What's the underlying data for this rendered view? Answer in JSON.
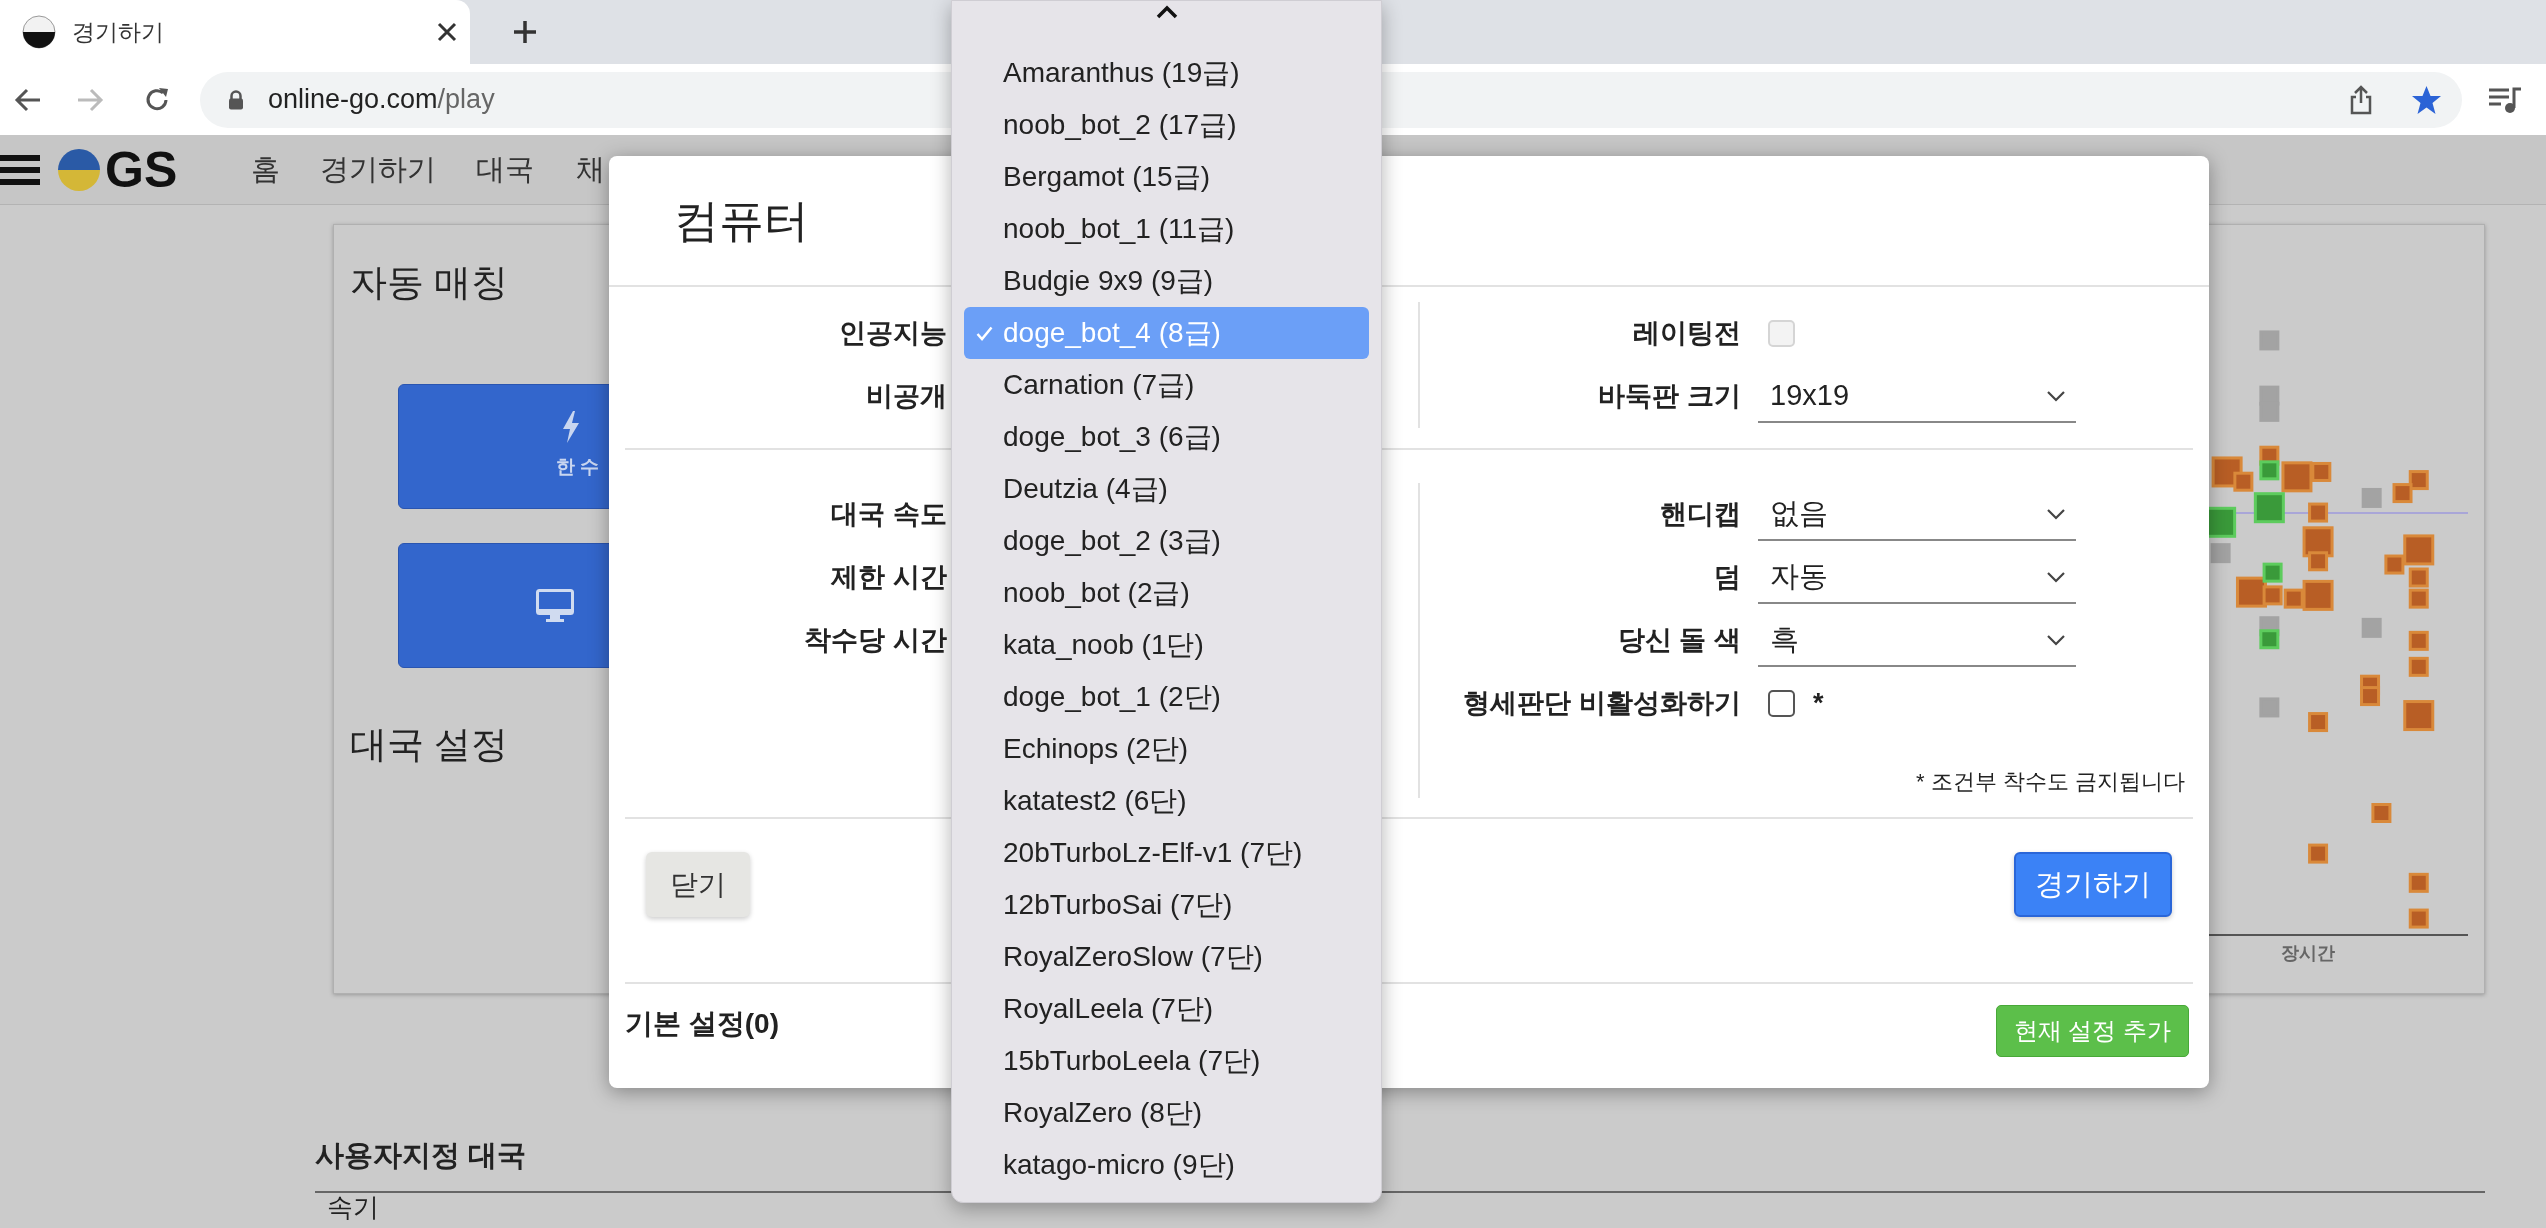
{
  "browser": {
    "tab": {
      "title": "경기하기"
    },
    "url": {
      "host": "online-go.com",
      "path": "/play"
    }
  },
  "nav": {
    "logo_text": "GS",
    "items": [
      "홈",
      "경기하기",
      "대국",
      "채"
    ]
  },
  "automatch": {
    "title": "자동 매칭",
    "buttons": [
      {
        "kind": "quick",
        "subtitle": "한 수"
      },
      {
        "kind": "computer"
      }
    ]
  },
  "game_settings": {
    "title": "대국 설정"
  },
  "chart": {
    "xlabel": "장시간"
  },
  "custom_games": {
    "title": "사용자지정 대국",
    "columns": [
      "속기"
    ]
  },
  "dialog": {
    "title": "컴퓨터",
    "sections": [
      {
        "left": [
          "인공지능",
          "비공개"
        ],
        "right": [
          {
            "kind": "checkbox",
            "label": "레이팅전",
            "checked": false,
            "disabled": true
          },
          {
            "kind": "select",
            "label": "바둑판 크기",
            "value": "19x19"
          }
        ]
      },
      {
        "left": [
          "대국 속도",
          "제한 시간",
          "착수당 시간"
        ],
        "right": [
          {
            "kind": "select",
            "label": "핸디캡",
            "value": "없음"
          },
          {
            "kind": "select",
            "label": "덤",
            "value": "자동"
          },
          {
            "kind": "select",
            "label": "당신 돌 색",
            "value": "흑"
          },
          {
            "kind": "checkbox",
            "label": "형세판단 비활성화하기",
            "checked": false,
            "disabled": false,
            "note": "*"
          }
        ],
        "footnote": "* 조건부 착수도 금지됩니다"
      }
    ],
    "close_button": "닫기",
    "play_button": "경기하기",
    "presets_label": "기본 설정(0)",
    "add_preset_button": "현재 설정 추가"
  },
  "dropdown": {
    "options": [
      {
        "label": "Amaranthus (19급)",
        "selected": false
      },
      {
        "label": "noob_bot_2 (17급)",
        "selected": false
      },
      {
        "label": "Bergamot (15급)",
        "selected": false
      },
      {
        "label": "noob_bot_1 (11급)",
        "selected": false
      },
      {
        "label": "Budgie 9x9 (9급)",
        "selected": false
      },
      {
        "label": "doge_bot_4 (8급)",
        "selected": true
      },
      {
        "label": "Carnation (7급)",
        "selected": false
      },
      {
        "label": "doge_bot_3 (6급)",
        "selected": false
      },
      {
        "label": "Deutzia (4급)",
        "selected": false
      },
      {
        "label": "doge_bot_2 (3급)",
        "selected": false
      },
      {
        "label": "noob_bot (2급)",
        "selected": false
      },
      {
        "label": "kata_noob (1단)",
        "selected": false
      },
      {
        "label": "doge_bot_1 (2단)",
        "selected": false
      },
      {
        "label": "Echinops (2단)",
        "selected": false
      },
      {
        "label": "katatest2 (6단)",
        "selected": false
      },
      {
        "label": "20bTurboLz-Elf-v1 (7단)",
        "selected": false
      },
      {
        "label": "12bTurboSai (7단)",
        "selected": false
      },
      {
        "label": "RoyalZeroSlow (7단)",
        "selected": false
      },
      {
        "label": "RoyalLeela (7단)",
        "selected": false
      },
      {
        "label": "15bTurboLeela (7단)",
        "selected": false
      },
      {
        "label": "RoyalZero (8단)",
        "selected": false
      },
      {
        "label": "katago-micro (9단)",
        "selected": false
      }
    ]
  }
}
